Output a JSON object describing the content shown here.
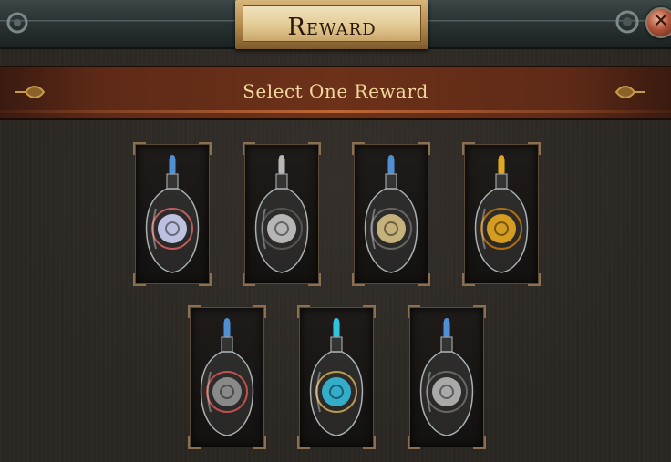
{
  "header": {
    "title": "Reward"
  },
  "banner": {
    "subtitle": "Select One Reward"
  },
  "rewards": [
    {
      "icon": "diamond-flask-icon",
      "stopper": "#4f8fd4",
      "emblem": "#d7dcff",
      "ring": "#c55a5a"
    },
    {
      "icon": "silver-flask-icon",
      "stopper": "#b8b8b8",
      "emblem": "#cfcfcf",
      "ring": "#555"
    },
    {
      "icon": "quicksilver-flask-icon",
      "stopper": "#4f8fd4",
      "emblem": "#e0c98a",
      "ring": "#666"
    },
    {
      "icon": "gold-flask-icon",
      "stopper": "#e2a820",
      "emblem": "#f2b01e",
      "ring": "#b07010"
    },
    {
      "icon": "granite-flask-icon",
      "stopper": "#4f8fd4",
      "emblem": "#9a9a9a",
      "ring": "#c05050"
    },
    {
      "icon": "sapphire-flask-icon",
      "stopper": "#2fc3e0",
      "emblem": "#35c4e6",
      "ring": "#b89a50"
    },
    {
      "icon": "basalt-flask-icon",
      "stopper": "#4f8fd4",
      "emblem": "#bfbfbf",
      "ring": "#666"
    }
  ]
}
